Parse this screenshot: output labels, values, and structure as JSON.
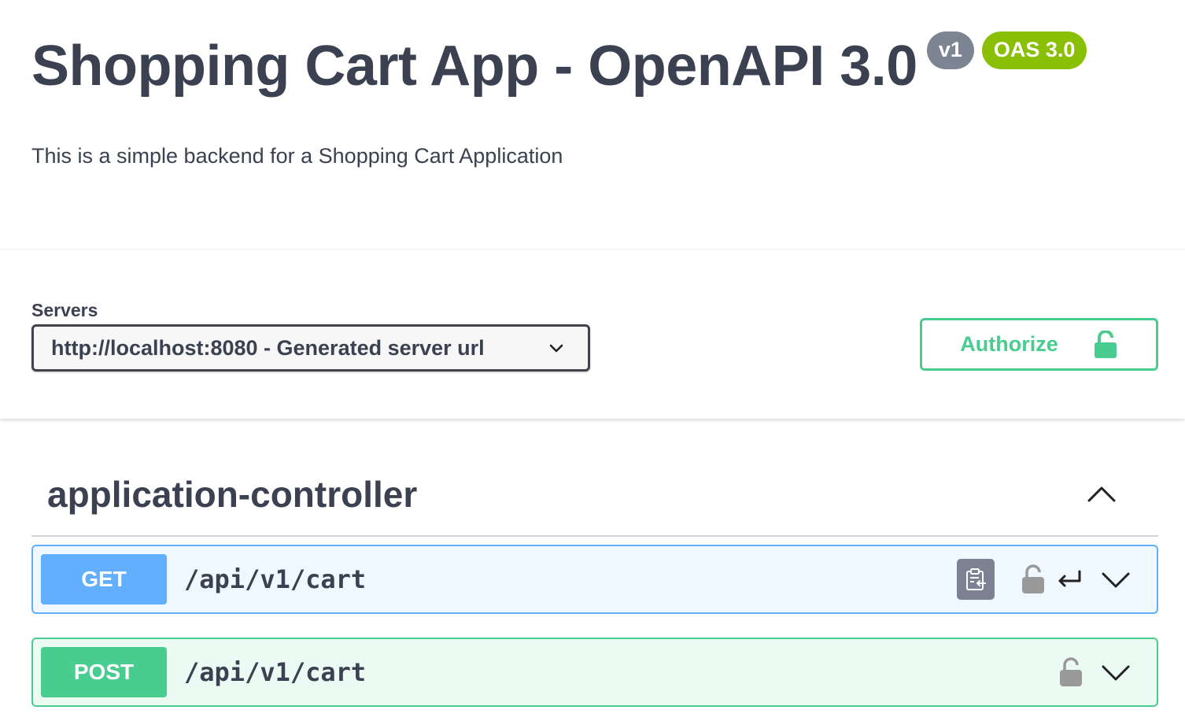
{
  "info": {
    "title": "Shopping Cart App - OpenAPI 3.0",
    "version_badge": "v1",
    "oas_badge": "OAS 3.0",
    "description": "This is a simple backend for a Shopping Cart Application"
  },
  "servers": {
    "label": "Servers",
    "selected": "http://localhost:8080 - Generated server url"
  },
  "authorize": {
    "label": "Authorize"
  },
  "tags": [
    {
      "name": "application-controller",
      "operations": [
        {
          "method": "GET",
          "path": "/api/v1/cart"
        },
        {
          "method": "POST",
          "path": "/api/v1/cart"
        }
      ]
    }
  ],
  "colors": {
    "text": "#3b4151",
    "get": "#61affe",
    "post": "#49cc90",
    "version_badge": "#7d8492",
    "oas_badge": "#89bf04"
  },
  "icons": {
    "server_dropdown": "chevron-down-icon",
    "authorize": "unlocked-padlock-icon",
    "tag_toggle": "chevron-up-icon",
    "copy": "clipboard-copy-icon",
    "lock": "padlock-icon",
    "return": "return-arrow-icon",
    "expand": "chevron-down-icon"
  }
}
